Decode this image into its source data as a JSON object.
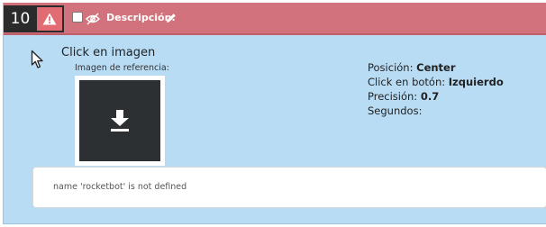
{
  "step": {
    "number": "10",
    "alert_icon": "warning-triangle-icon",
    "visibility_icon": "eye-slash-icon",
    "description_label": "Descripción:",
    "edit_icon": "pencil-icon",
    "colors": {
      "header": "#d2727d",
      "alert_badge": "#e26c73",
      "body": "#b9dcf5",
      "number_bg": "#2b2b2b"
    }
  },
  "action": {
    "icon": "mouse-pointer-icon",
    "title": "Click en imagen",
    "reference_label": "Imagen de referencia:",
    "reference_image_icon": "download-icon"
  },
  "params": {
    "position_label": "Posición:",
    "position_value": "Center",
    "button_label": "Click en botón:",
    "button_value": "Izquierdo",
    "precision_label": "Precisión:",
    "precision_value": "0.7",
    "seconds_label": "Segundos:"
  },
  "error": {
    "message": "name 'rocketbot' is not defined"
  }
}
